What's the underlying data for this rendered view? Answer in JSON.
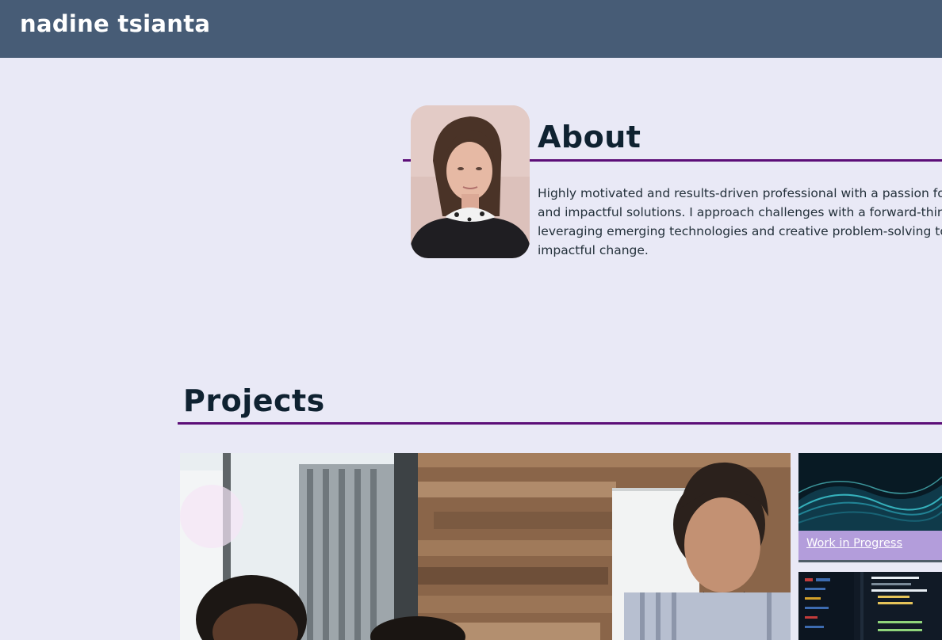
{
  "header": {
    "site_name": "nadine tsianta"
  },
  "about": {
    "title": "About",
    "lines": [
      "Highly motivated and results-driven professional with a passion fo",
      "and impactful solutions. I approach challenges with a forward-thir",
      "leveraging emerging technologies and creative problem-solving to",
      "impactful change."
    ]
  },
  "projects": {
    "title": "Projects",
    "cards": [
      {
        "caption": "Work in Progress"
      }
    ]
  },
  "colors": {
    "header_bg": "#475c76",
    "page_bg": "#e9e9f6",
    "accent_rule": "#5c0e78",
    "caption_bg": "#b39ddb"
  },
  "icons": {
    "profile_photo": "portrait-photo",
    "featured_image": "team-meeting-photo",
    "wip_thumb": "data-wave-image",
    "code_thumb": "code-screen-image"
  }
}
